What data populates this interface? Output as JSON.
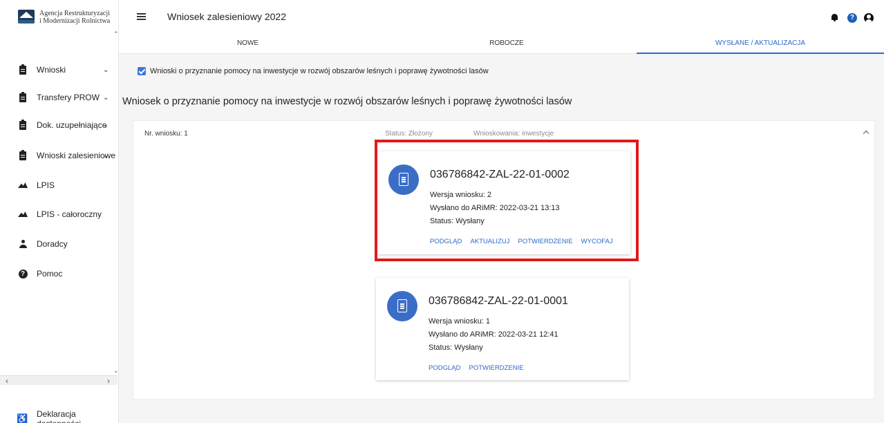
{
  "brand": {
    "line1": "Agencja Restrukturyzacji",
    "line2": "i Modernizacji Rolnictwa"
  },
  "app": {
    "title": "Wniosek zalesieniowy 2022"
  },
  "sidebar": {
    "items": [
      {
        "label": "Wnioski",
        "icon": "clipboard-icon",
        "expandable": true
      },
      {
        "label": "Transfery PROW",
        "icon": "clipboard-icon",
        "expandable": true
      },
      {
        "label": "Dok. uzupełniające",
        "icon": "clipboard-icon",
        "expandable": true
      },
      {
        "label": "Wnioski zalesieniowe",
        "icon": "clipboard-icon",
        "expandable": true
      },
      {
        "label": "LPIS",
        "icon": "landscape-icon",
        "expandable": false
      },
      {
        "label": "LPIS - całoroczny",
        "icon": "landscape-icon",
        "expandable": false
      },
      {
        "label": "Doradcy",
        "icon": "person-icon",
        "expandable": false
      },
      {
        "label": "Pomoc",
        "icon": "help-icon",
        "expandable": false
      }
    ],
    "accessibility_label": "Deklaracja dostępności"
  },
  "tabs": [
    {
      "label": "NOWE",
      "active": false
    },
    {
      "label": "ROBOCZE",
      "active": false
    },
    {
      "label": "WYSŁANE / AKTUALIZACJA",
      "active": true
    }
  ],
  "filter": {
    "label": "Wnioski o przyznanie pomocy na inwestycje w rozwój obszarów leśnych i poprawę żywotności lasów",
    "checked": true
  },
  "section": {
    "title": "Wniosek o przyznanie pomocy na inwestycje w rozwój obszarów leśnych i poprawę żywotności lasów"
  },
  "panel": {
    "number": "Nr. wniosku: 1",
    "status": "Status: Złożony",
    "type": "Wnioskowania: inwestycje"
  },
  "cards": [
    {
      "number": "036786842-ZAL-22-01-0002",
      "version": "Wersja wniosku: 2",
      "sent": "Wysłano do ARiMR: 2022-03-21 13:13",
      "status": "Status: Wysłany",
      "actions": [
        "PODGLĄD",
        "AKTUALIZUJ",
        "POTWIERDZENIE",
        "WYCOFAJ"
      ],
      "highlighted": true
    },
    {
      "number": "036786842-ZAL-22-01-0001",
      "version": "Wersja wniosku: 1",
      "sent": "Wysłano do ARiMR: 2022-03-21 12:41",
      "status": "Status: Wysłany",
      "actions": [
        "PODGLĄD",
        "POTWIERDZENIE"
      ],
      "highlighted": false
    }
  ],
  "colors": {
    "accent": "#2a6ac9",
    "highlight": "#e11919",
    "icon_bg": "#3a6ec6"
  }
}
